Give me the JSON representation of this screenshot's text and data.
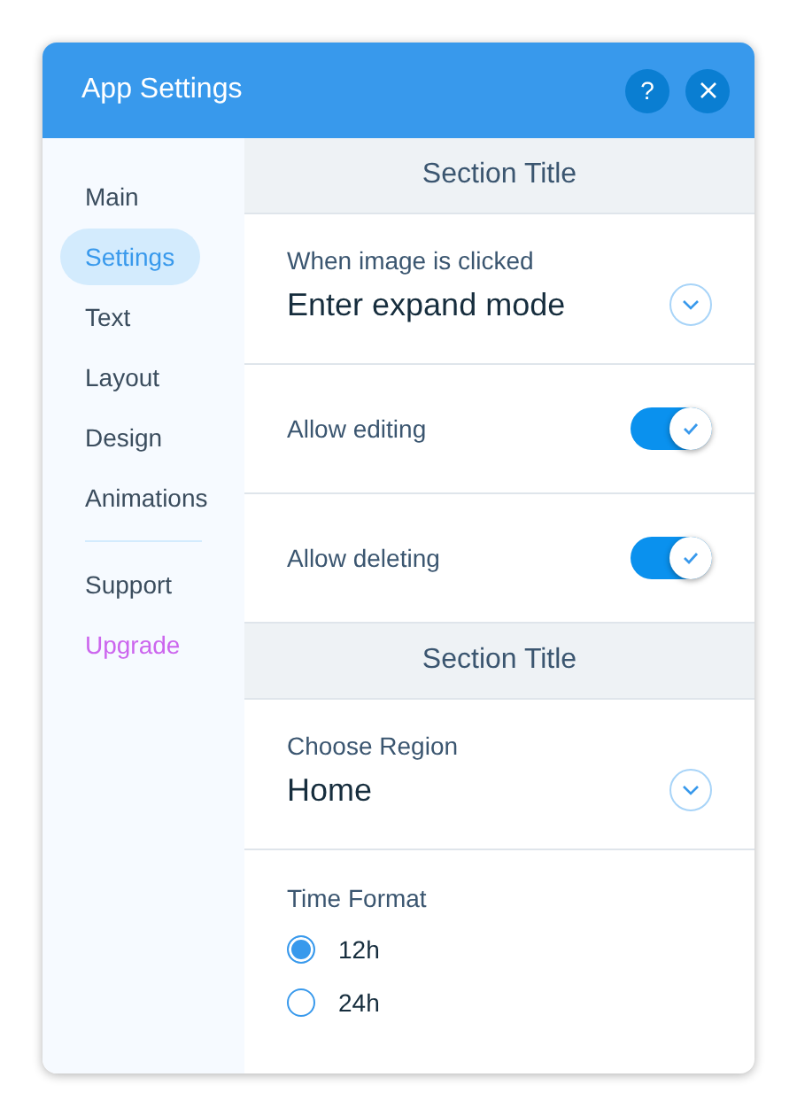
{
  "window": {
    "title": "App Settings"
  },
  "header_buttons": [
    {
      "kind": "help",
      "label": "?"
    },
    {
      "kind": "close"
    }
  ],
  "sidebar": {
    "items": [
      {
        "label": "Main",
        "selected": false
      },
      {
        "label": "Settings",
        "selected": true
      },
      {
        "label": "Text",
        "selected": false
      },
      {
        "label": "Layout",
        "selected": false
      },
      {
        "label": "Design",
        "selected": false
      },
      {
        "label": "Animations",
        "selected": false
      }
    ],
    "footer_items": [
      {
        "label": "Support",
        "kind": "link"
      },
      {
        "label": "Upgrade",
        "kind": "upgrade"
      }
    ]
  },
  "sections": [
    {
      "title": "Section Title",
      "rows": [
        {
          "kind": "dropdown",
          "label": "When image is clicked",
          "value": "Enter expand mode"
        },
        {
          "kind": "toggle",
          "label": "Allow editing",
          "on": true
        },
        {
          "kind": "toggle",
          "label": "Allow deleting",
          "on": true
        }
      ]
    },
    {
      "title": "Section Title",
      "rows": [
        {
          "kind": "dropdown",
          "label": "Choose Region",
          "value": "Home"
        },
        {
          "kind": "radio",
          "label": "Time Format",
          "options": [
            {
              "label": "12h",
              "selected": true
            },
            {
              "label": "24h",
              "selected": false
            }
          ]
        }
      ]
    }
  ]
}
